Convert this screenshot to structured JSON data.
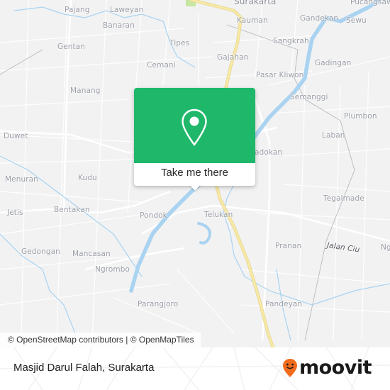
{
  "map": {
    "places": [
      {
        "name": "Surakarta",
        "kind": "city"
      },
      {
        "name": "Pajang"
      },
      {
        "name": "Laweyan"
      },
      {
        "name": "Kauman"
      },
      {
        "name": "Gandekan"
      },
      {
        "name": "Sewu"
      },
      {
        "name": "Pucangsawit"
      },
      {
        "name": "Banaran"
      },
      {
        "name": "Sangkrah"
      },
      {
        "name": "Gentan"
      },
      {
        "name": "Tipes"
      },
      {
        "name": "Gajahan"
      },
      {
        "name": "Gadingan"
      },
      {
        "name": "Cemani"
      },
      {
        "name": "Pasar Kliwon"
      },
      {
        "name": "Manang"
      },
      {
        "name": "Semanggi"
      },
      {
        "name": "Plumbon"
      },
      {
        "name": "Duwet"
      },
      {
        "name": "Laban"
      },
      {
        "name": "Joyotakan"
      },
      {
        "name": "Kudu"
      },
      {
        "name": "Menuran"
      },
      {
        "name": "Tegalmade"
      },
      {
        "name": "Jetis"
      },
      {
        "name": "Bentakan"
      },
      {
        "name": "Pondok"
      },
      {
        "name": "Telukan"
      },
      {
        "name": "Pranan"
      },
      {
        "name": "Jalan Ciu",
        "kind": "road"
      },
      {
        "name": "Ngombakan"
      },
      {
        "name": "Gedongan"
      },
      {
        "name": "Mancasan"
      },
      {
        "name": "Ngrombo"
      },
      {
        "name": "Parangjoro"
      },
      {
        "name": "Pandeyan"
      }
    ],
    "visible_labels": {
      "surakarta": "Surakarta",
      "pajang": "Pajang",
      "laweyan": "Laweyan",
      "kauman": "Kauman",
      "gandekan": "Gandekan",
      "sewu": "Sewu",
      "pucangsawit": "Pucangsawit",
      "banaran": "Banaran",
      "sangkrah": "Sangkrah",
      "gentan": "Gentan",
      "tipes": "Tipes",
      "gajahan": "Gajahan",
      "gadingan": "Gadingan",
      "cemani": "Cemani",
      "pasar_kliwon": "Pasar Kliwon",
      "manang": "Manang",
      "semanggi": "Semanggi",
      "plumbon": "Plumbon",
      "duwet": "Duwet",
      "laban": "Laban",
      "joyotakan": "adokan",
      "kudu": "Kudu",
      "menuran": "Menuran",
      "tegalmade": "Tegalmade",
      "jetis": "Jetis",
      "bentakan": "Bentakan",
      "pondok": "Pondok",
      "telukan": "Telukan",
      "pranan": "Pranan",
      "jalan_ciu": "Jalan Ciu",
      "ngombakan": "Ng",
      "gedongan": "Gedongan",
      "mancasan": "Mancasan",
      "ngrombo": "Ngrombo",
      "parangjoro": "Parangjoro",
      "pandeyan": "Pandeyan"
    },
    "colors": {
      "background": "#f2f2f3",
      "road": "#ffffff",
      "major_road": "#f5e39a",
      "river": "#a9d3f0",
      "park": "#c8e6a0"
    }
  },
  "popup": {
    "icon": "map-pin-icon",
    "action_label": "Take me there",
    "accent": "#1fb86a"
  },
  "attribution": "© OpenStreetMap contributors | © OpenMapTiles",
  "footer": {
    "location_title": "Masjid Darul Falah, Surakarta",
    "brand": "moovit",
    "brand_icon": "moovit-pin-smiley-icon",
    "brand_color": "#f26b1d"
  }
}
